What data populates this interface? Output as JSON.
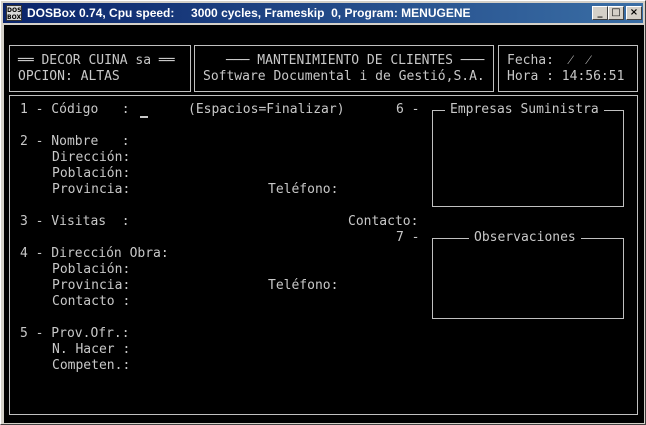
{
  "window": {
    "title": "DOSBox 0.74, Cpu speed:     3000 cycles, Frameskip  0, Program: MENUGENE",
    "icon_text_top": "DOS",
    "icon_text_bottom": "BOX",
    "buttons": {
      "minimize": "_",
      "maximize": "□",
      "close": "×"
    }
  },
  "header": {
    "company": "══ DECOR CUINA sa ══",
    "option": "OPCION: ALTAS",
    "title": "─── MANTENIMIENTO DE CLIENTES ───",
    "subtitle": "Software Documental i de Gestió,S.A.",
    "date_label": "Fecha:  ⁄  ⁄",
    "time_label": "Hora : 14:56:51"
  },
  "form": {
    "codigo": "1 - Código   :",
    "hint": "(Espacios=Finalizar)",
    "nombre": "2 - Nombre   :",
    "direccion": "Dirección:",
    "poblacion": "Población:",
    "provincia": "Provincia:",
    "telefono": "Teléfono:",
    "visitas": "3 - Visitas  :",
    "contacto": "Contacto:",
    "direccion_obra": "4 - Dirección Obra:",
    "poblacion2": "Población:",
    "provincia2": "Provincia:",
    "telefono2": "Teléfono:",
    "contacto2": "Contacto :",
    "prov_ofr": "5 - Prov.Ofr.:",
    "n_hacer": "N. Hacer :",
    "competen": "Competen.:",
    "empresas_num": "6 -",
    "empresas_label": "Empresas Suministra",
    "observ_num": "7 -",
    "observ_label": "Observaciones"
  }
}
